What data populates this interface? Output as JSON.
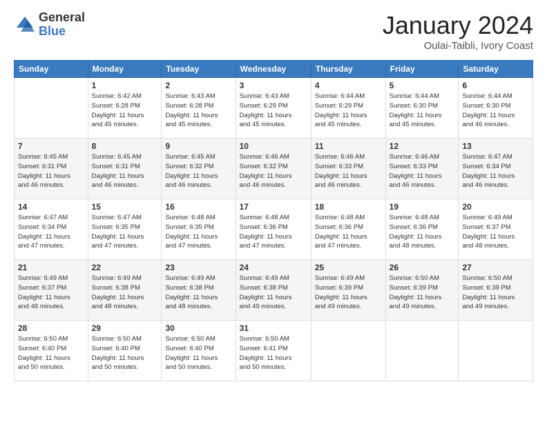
{
  "header": {
    "logo": {
      "general": "General",
      "blue": "Blue"
    },
    "title": "January 2024",
    "subtitle": "Oulai-Taibli, Ivory Coast"
  },
  "days_of_week": [
    "Sunday",
    "Monday",
    "Tuesday",
    "Wednesday",
    "Thursday",
    "Friday",
    "Saturday"
  ],
  "weeks": [
    [
      {
        "day": "",
        "info": ""
      },
      {
        "day": "1",
        "info": "Sunrise: 6:42 AM\nSunset: 6:28 PM\nDaylight: 11 hours\nand 45 minutes."
      },
      {
        "day": "2",
        "info": "Sunrise: 6:43 AM\nSunset: 6:28 PM\nDaylight: 11 hours\nand 45 minutes."
      },
      {
        "day": "3",
        "info": "Sunrise: 6:43 AM\nSunset: 6:29 PM\nDaylight: 11 hours\nand 45 minutes."
      },
      {
        "day": "4",
        "info": "Sunrise: 6:44 AM\nSunset: 6:29 PM\nDaylight: 11 hours\nand 45 minutes."
      },
      {
        "day": "5",
        "info": "Sunrise: 6:44 AM\nSunset: 6:30 PM\nDaylight: 11 hours\nand 45 minutes."
      },
      {
        "day": "6",
        "info": "Sunrise: 6:44 AM\nSunset: 6:30 PM\nDaylight: 11 hours\nand 46 minutes."
      }
    ],
    [
      {
        "day": "7",
        "info": "Sunrise: 6:45 AM\nSunset: 6:31 PM\nDaylight: 11 hours\nand 46 minutes."
      },
      {
        "day": "8",
        "info": "Sunrise: 6:45 AM\nSunset: 6:31 PM\nDaylight: 11 hours\nand 46 minutes."
      },
      {
        "day": "9",
        "info": "Sunrise: 6:45 AM\nSunset: 6:32 PM\nDaylight: 11 hours\nand 46 minutes."
      },
      {
        "day": "10",
        "info": "Sunrise: 6:46 AM\nSunset: 6:32 PM\nDaylight: 11 hours\nand 46 minutes."
      },
      {
        "day": "11",
        "info": "Sunrise: 6:46 AM\nSunset: 6:33 PM\nDaylight: 11 hours\nand 46 minutes."
      },
      {
        "day": "12",
        "info": "Sunrise: 6:46 AM\nSunset: 6:33 PM\nDaylight: 11 hours\nand 46 minutes."
      },
      {
        "day": "13",
        "info": "Sunrise: 6:47 AM\nSunset: 6:34 PM\nDaylight: 11 hours\nand 46 minutes."
      }
    ],
    [
      {
        "day": "14",
        "info": "Sunrise: 6:47 AM\nSunset: 6:34 PM\nDaylight: 11 hours\nand 47 minutes."
      },
      {
        "day": "15",
        "info": "Sunrise: 6:47 AM\nSunset: 6:35 PM\nDaylight: 11 hours\nand 47 minutes."
      },
      {
        "day": "16",
        "info": "Sunrise: 6:48 AM\nSunset: 6:35 PM\nDaylight: 11 hours\nand 47 minutes."
      },
      {
        "day": "17",
        "info": "Sunrise: 6:48 AM\nSunset: 6:36 PM\nDaylight: 11 hours\nand 47 minutes."
      },
      {
        "day": "18",
        "info": "Sunrise: 6:48 AM\nSunset: 6:36 PM\nDaylight: 11 hours\nand 47 minutes."
      },
      {
        "day": "19",
        "info": "Sunrise: 6:48 AM\nSunset: 6:36 PM\nDaylight: 11 hours\nand 48 minutes."
      },
      {
        "day": "20",
        "info": "Sunrise: 6:49 AM\nSunset: 6:37 PM\nDaylight: 11 hours\nand 48 minutes."
      }
    ],
    [
      {
        "day": "21",
        "info": "Sunrise: 6:49 AM\nSunset: 6:37 PM\nDaylight: 11 hours\nand 48 minutes."
      },
      {
        "day": "22",
        "info": "Sunrise: 6:49 AM\nSunset: 6:38 PM\nDaylight: 11 hours\nand 48 minutes."
      },
      {
        "day": "23",
        "info": "Sunrise: 6:49 AM\nSunset: 6:38 PM\nDaylight: 11 hours\nand 48 minutes."
      },
      {
        "day": "24",
        "info": "Sunrise: 6:49 AM\nSunset: 6:38 PM\nDaylight: 11 hours\nand 49 minutes."
      },
      {
        "day": "25",
        "info": "Sunrise: 6:49 AM\nSunset: 6:39 PM\nDaylight: 11 hours\nand 49 minutes."
      },
      {
        "day": "26",
        "info": "Sunrise: 6:50 AM\nSunset: 6:39 PM\nDaylight: 11 hours\nand 49 minutes."
      },
      {
        "day": "27",
        "info": "Sunrise: 6:50 AM\nSunset: 6:39 PM\nDaylight: 11 hours\nand 49 minutes."
      }
    ],
    [
      {
        "day": "28",
        "info": "Sunrise: 6:50 AM\nSunset: 6:40 PM\nDaylight: 11 hours\nand 50 minutes."
      },
      {
        "day": "29",
        "info": "Sunrise: 6:50 AM\nSunset: 6:40 PM\nDaylight: 11 hours\nand 50 minutes."
      },
      {
        "day": "30",
        "info": "Sunrise: 6:50 AM\nSunset: 6:40 PM\nDaylight: 11 hours\nand 50 minutes."
      },
      {
        "day": "31",
        "info": "Sunrise: 6:50 AM\nSunset: 6:41 PM\nDaylight: 11 hours\nand 50 minutes."
      },
      {
        "day": "",
        "info": ""
      },
      {
        "day": "",
        "info": ""
      },
      {
        "day": "",
        "info": ""
      }
    ]
  ]
}
